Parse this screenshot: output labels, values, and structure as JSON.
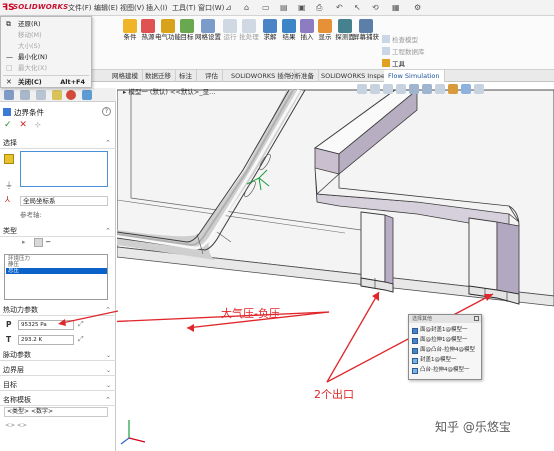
{
  "app": {
    "logo_mark": "ꟻS",
    "logo_text": "SOLIDWORKS"
  },
  "menubar": {
    "items": [
      "文件(F)",
      "编辑(E)",
      "视图(V)",
      "插入(I)",
      "工具(T)",
      "窗口(W)"
    ],
    "pin": "⊿"
  },
  "window_menu": {
    "items": [
      {
        "icon": "⧉",
        "label": "还原(R)",
        "shortcut": "",
        "enabled": true
      },
      {
        "icon": "",
        "label": "移动(M)",
        "shortcut": "",
        "enabled": false
      },
      {
        "icon": "",
        "label": "大小(S)",
        "shortcut": "",
        "enabled": false
      },
      {
        "icon": "—",
        "label": "最小化(N)",
        "shortcut": "",
        "enabled": true
      },
      {
        "icon": "□",
        "label": "最大化(X)",
        "shortcut": "",
        "enabled": false
      },
      {
        "icon": "✕",
        "label": "关闭(C)",
        "shortcut": "Alt+F4",
        "enabled": true
      }
    ]
  },
  "command_manager": {
    "buttons": [
      "条件",
      "热源",
      "电气功能",
      "目标",
      "网格设置",
      "运行",
      "批处理",
      "求解",
      "结果",
      "插入",
      "显示",
      "探测面",
      "屏幕捕获"
    ],
    "side_items": [
      "检查模型",
      "工程数据库",
      "工具"
    ]
  },
  "tabs": [
    "网格建模",
    "数据迁移",
    "标注",
    "评估",
    "SOLIDWORKS 插件",
    "分析准备",
    "SOLIDWORKS Inspection",
    "Flow Simulation"
  ],
  "active_tab": "Flow Simulation",
  "property_manager": {
    "title": "边界条件",
    "help": "?",
    "ok": "✓",
    "cancel": "✕",
    "pin": "⊹",
    "sections": {
      "selection": "选择",
      "type": "类型",
      "thermo": "热动力参数",
      "fluctuation": "脉动参数",
      "boundary_layer": "边界层",
      "goal": "目标",
      "name_template": "名称模板"
    },
    "coord_system": "全局坐标系",
    "reference_axis": "参考轴:",
    "type_list": [
      "环境压力",
      "静压",
      "总压"
    ],
    "selected_type_index": 2,
    "pressure_label": "P",
    "pressure_value": "95325 Pa",
    "temperature_label": "T",
    "temperature_value": "293.2 K",
    "name_template_value": "<类型> <数字>"
  },
  "viewport": {
    "tree_path": "▸ 模型一 (默认) <<默认>_显..."
  },
  "popup": {
    "header": "选择其他",
    "items": [
      "面@封盖1@模型一",
      "面@拉伸1@模型一",
      "面@凸台-拉伸4@模型",
      "封盖1@模型一",
      "凸台-拉伸4@模型一"
    ]
  },
  "annotations": {
    "pressure_note": "大气压-负压",
    "outlets_note": "2个出口",
    "color": "#e0262a"
  },
  "watermark": "知乎 @乐悠宝"
}
